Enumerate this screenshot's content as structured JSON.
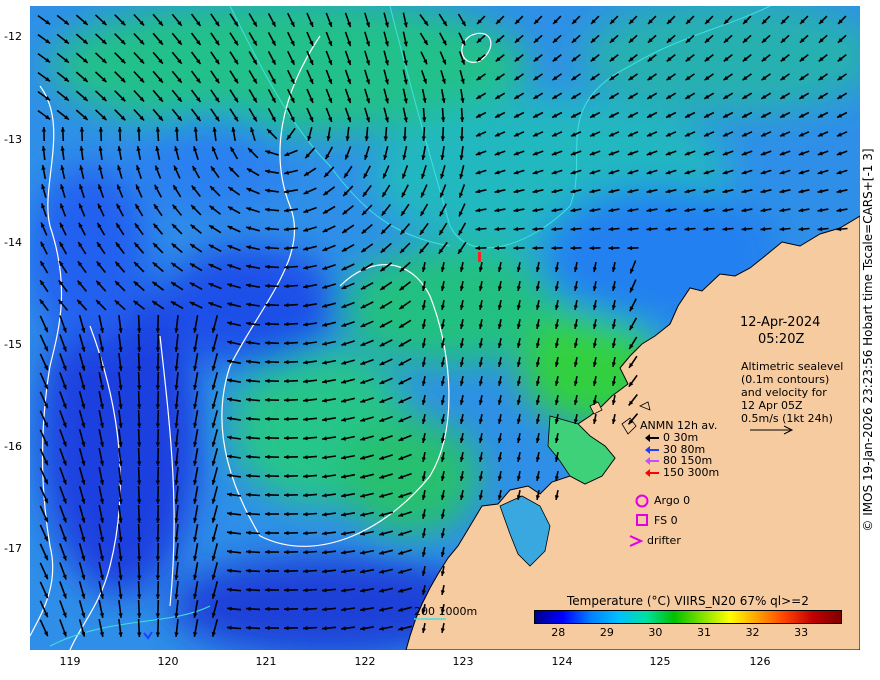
{
  "title": {
    "date": "12-Apr-2024",
    "time": "05:20Z"
  },
  "altimetry_note": [
    "Altimetric sealevel",
    "(0.1m contours)",
    "and velocity for",
    "12 Apr 05Z",
    "0.5m/s (1kt 24h)"
  ],
  "anmn": {
    "heading": "ANMN 12h av.",
    "rows": [
      {
        "label": "0 30m",
        "color": "#000000"
      },
      {
        "label": "30 80m",
        "color": "#1f3fff"
      },
      {
        "label": "80 150m",
        "color": "#c050ff"
      },
      {
        "label": "150 300m",
        "color": "#ff0000"
      }
    ]
  },
  "argo_label": "Argo 0",
  "fs_label": "FS 0",
  "drifter_label": "drifter",
  "bathy_label": "200  1000m",
  "colorbar": {
    "title": "Temperature (°C) VIIRS_N20 67% ql>=2",
    "ticks": [
      "28",
      "29",
      "30",
      "31",
      "32",
      "33"
    ],
    "range": [
      27.5,
      33.8
    ],
    "colors": [
      "#00008b",
      "#0000ff",
      "#0080ff",
      "#00c0ff",
      "#00e0a0",
      "#00c000",
      "#80e000",
      "#ffff00",
      "#ffa000",
      "#ff4000",
      "#c00000",
      "#800000"
    ]
  },
  "credit": "© IMOS 19-Jan-2026 23:23:56 Hobart time Tscale=CARS+[-1 3]",
  "axes": {
    "y_ticks": [
      "-12",
      "-13",
      "-14",
      "-15",
      "-16",
      "-17"
    ],
    "x_ticks": [
      "119",
      "120",
      "121",
      "122",
      "123",
      "124",
      "125",
      "126"
    ]
  },
  "colors": {
    "land": "#f7cba0",
    "ocean_warm": "#20c070",
    "ocean_cool": "#2f7fff"
  }
}
